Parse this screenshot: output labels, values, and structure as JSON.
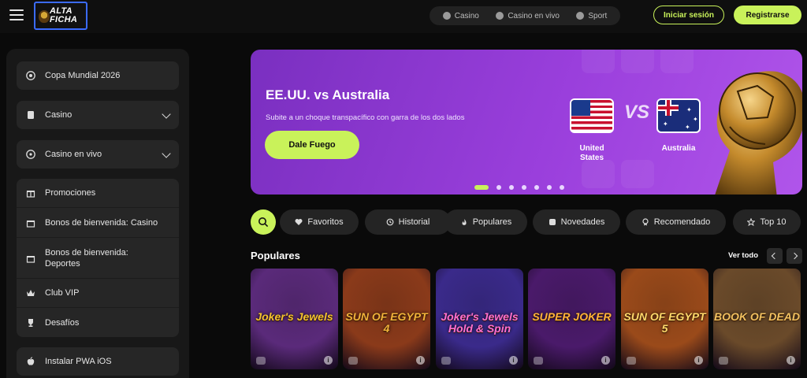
{
  "header": {
    "logo_line1": "ALTA",
    "logo_line2": "FICHA",
    "modes": [
      {
        "label": "Casino",
        "icon": "casino-chip-icon"
      },
      {
        "label": "Casino en vivo",
        "icon": "live-casino-icon"
      },
      {
        "label": "Sport",
        "icon": "sport-ball-icon"
      }
    ],
    "login_label": "Iniciar sesión",
    "register_label": "Registrarse"
  },
  "sidebar": {
    "items": [
      {
        "label": "Copa Mundial 2026",
        "icon": "soccer-ball-icon"
      },
      {
        "label": "Casino",
        "icon": "cards-icon"
      },
      {
        "label": "Casino en vivo",
        "icon": "roulette-icon"
      }
    ],
    "group": [
      {
        "label": "Promociones",
        "icon": "gift-icon"
      },
      {
        "label": "Bonos de bienvenida: Casino",
        "icon": "gift-box-icon"
      },
      {
        "label": "Bonos de bienvenida: Deportes",
        "icon": "gift-box-icon"
      },
      {
        "label": "Club VIP",
        "icon": "crown-icon"
      },
      {
        "label": "Desafíos",
        "icon": "trophy-icon"
      }
    ],
    "install": {
      "label": "Instalar PWA iOS",
      "icon": "apple-icon"
    }
  },
  "banner": {
    "title": "EE.UU. vs Australia",
    "subtitle": "Subite a un choque transpacífico con garra de los dos lados",
    "cta": "Dale Fuego",
    "vs": "VS",
    "team_left": "United States",
    "team_right": "Australia",
    "slides_count": 7,
    "active_slide": 1
  },
  "filters": [
    {
      "label": "Favoritos",
      "icon": "heart-icon"
    },
    {
      "label": "Historial",
      "icon": "history-icon"
    },
    {
      "label": "Populares",
      "icon": "flame-icon"
    },
    {
      "label": "Novedades",
      "icon": "new-badge-icon"
    },
    {
      "label": "Recomendado",
      "icon": "medal-icon"
    },
    {
      "label": "Top 10",
      "icon": "star-icon"
    }
  ],
  "populares": {
    "title": "Populares",
    "see_all": "Ver todo",
    "games": [
      {
        "title": "Joker's Jewels",
        "bg": "#5a2a7a"
      },
      {
        "title": "SUN OF EGYPT 4",
        "bg": "#8a3a1a"
      },
      {
        "title": "Joker's Jewels Hold & Spin",
        "bg": "#3a2a8a"
      },
      {
        "title": "SUPER JOKER",
        "bg": "#4a1a6a"
      },
      {
        "title": "SUN OF EGYPT 5",
        "bg": "#9a4a1a"
      },
      {
        "title": "BOOK OF DEAD",
        "bg": "#6a4a2a"
      }
    ]
  },
  "colors": {
    "accent": "#c9f25a",
    "banner": "#9a3fdc"
  }
}
